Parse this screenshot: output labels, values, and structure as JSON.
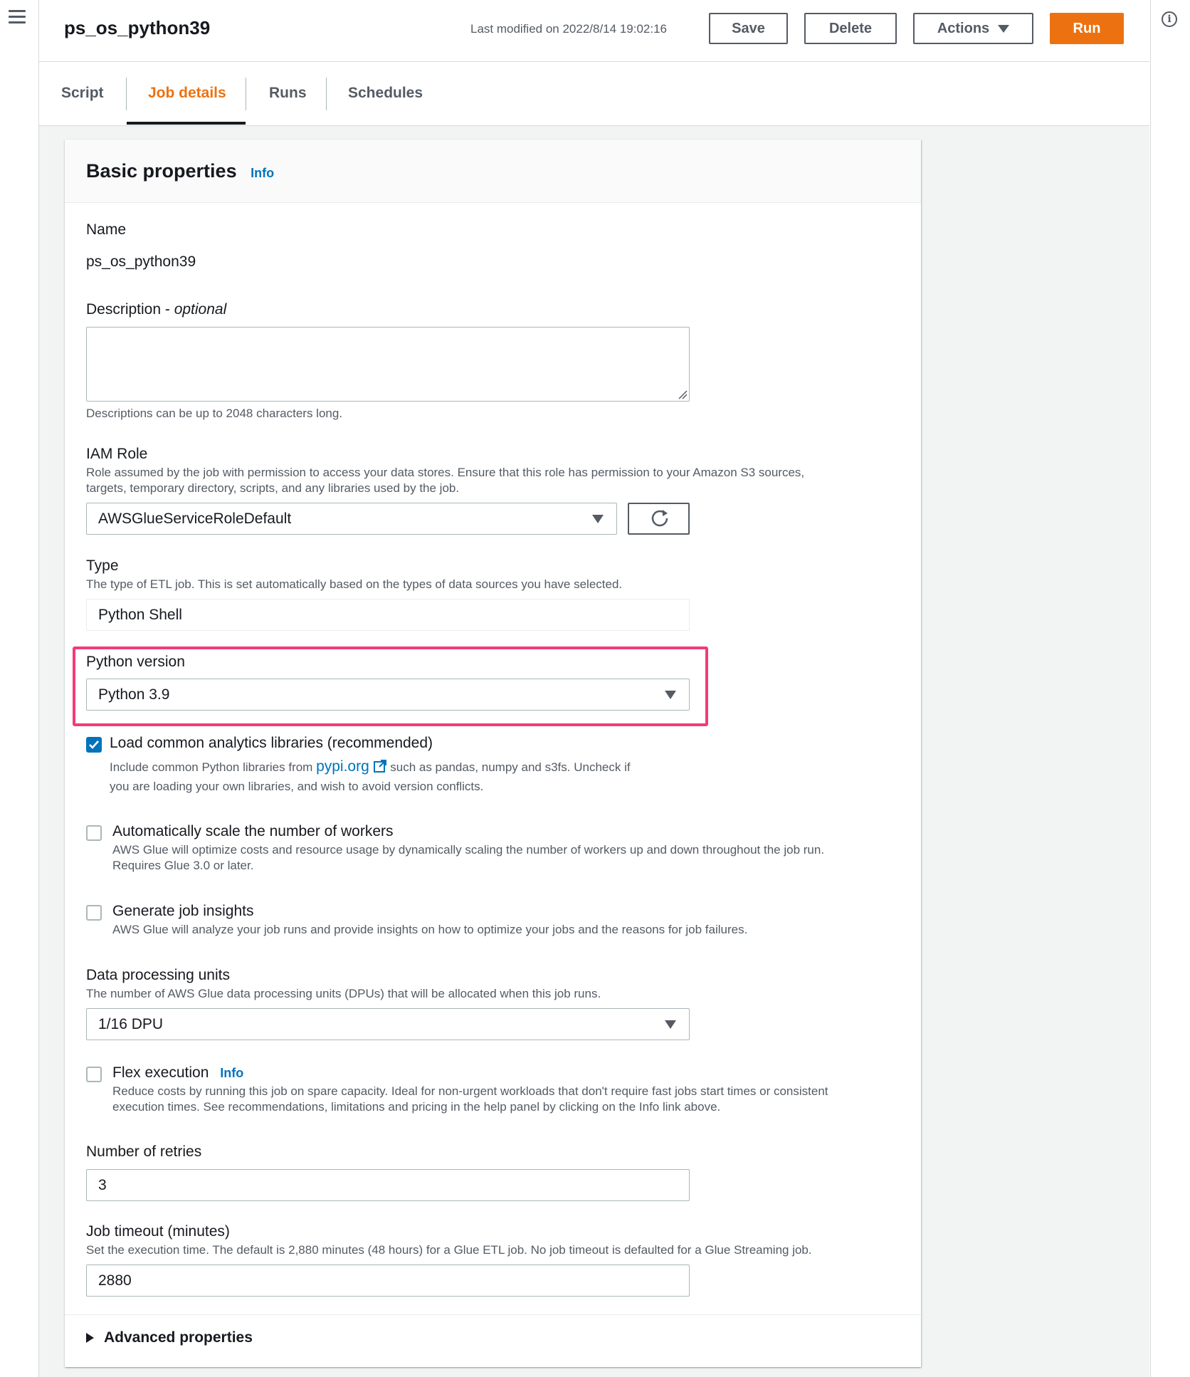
{
  "header": {
    "job_name": "ps_os_python39",
    "last_modified": "Last modified on 2022/8/14 19:02:16",
    "save_label": "Save",
    "delete_label": "Delete",
    "actions_label": "Actions",
    "run_label": "Run"
  },
  "tabs": [
    {
      "label": "Script",
      "active": false
    },
    {
      "label": "Job details",
      "active": true
    },
    {
      "label": "Runs",
      "active": false
    },
    {
      "label": "Schedules",
      "active": false
    }
  ],
  "colors": {
    "accent": "#ec7211",
    "link": "#0073bb",
    "highlight": "#f13c77"
  },
  "icons": {
    "menu": "hamburger-icon",
    "help": "info-circle-icon",
    "refresh": "refresh-icon",
    "external": "external-link-icon"
  },
  "basic": {
    "title": "Basic properties",
    "info": "Info",
    "name_label": "Name",
    "name_value": "ps_os_python39",
    "description_label": "Description - ",
    "description_optional": "optional",
    "description_value": "",
    "description_hint": "Descriptions can be up to 2048 characters long.",
    "iam_label": "IAM Role",
    "iam_desc_1": "Role assumed by the job with permission to access your data stores. Ensure that this role has permission to your Amazon S3 sources,",
    "iam_desc_2": "targets, temporary directory, scripts, and any libraries used by the job.",
    "iam_value": "AWSGlueServiceRoleDefault",
    "type_label": "Type",
    "type_desc": "The type of ETL job. This is set automatically based on the types of data sources you have selected.",
    "type_value": "Python Shell",
    "python_label": "Python version",
    "python_value": "Python 3.9",
    "load_libs_label": "Load common analytics libraries (recommended)",
    "load_libs_checked": true,
    "load_libs_desc_pre": "Include common Python libraries from ",
    "load_libs_link": "pypi.org",
    "load_libs_desc_post": " such as pandas, numpy and s3fs. Uncheck if",
    "load_libs_desc_2": "you are loading your own libraries, and wish to avoid version conflicts.",
    "autoscale_label": "Automatically scale the number of workers",
    "autoscale_checked": false,
    "autoscale_desc_1": "AWS Glue will optimize costs and resource usage by dynamically scaling the number of workers up and down throughout the job run.",
    "autoscale_desc_2": "Requires Glue 3.0 or later.",
    "insights_label": "Generate job insights",
    "insights_checked": false,
    "insights_desc": "AWS Glue will analyze your job runs and provide insights on how to optimize your jobs and the reasons for job failures.",
    "dpu_label": "Data processing units",
    "dpu_desc": "The number of AWS Glue data processing units (DPUs) that will be allocated when this job runs.",
    "dpu_value": "1/16 DPU",
    "flex_label": "Flex execution",
    "flex_info": "Info",
    "flex_checked": false,
    "flex_desc_1": "Reduce costs by running this job on spare capacity. Ideal for non-urgent workloads that don't require fast jobs start times or consistent",
    "flex_desc_2": "execution times. See recommendations, limitations and pricing in the help panel by clicking on the Info link above.",
    "retries_label": "Number of retries",
    "retries_value": "3",
    "timeout_label": "Job timeout (minutes)",
    "timeout_desc": "Set the execution time. The default is 2,880 minutes (48 hours) for a Glue ETL job. No job timeout is defaulted for a Glue Streaming job.",
    "timeout_value": "2880",
    "advanced_label": "Advanced properties"
  }
}
